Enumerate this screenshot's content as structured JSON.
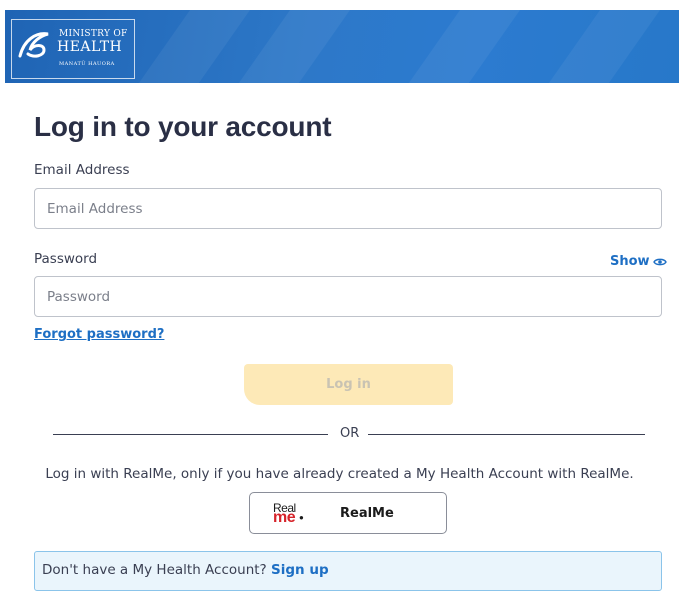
{
  "header": {
    "logo": {
      "line1": "MINISTRY OF",
      "line2": "HEALTH",
      "line3": "MANATŪ HAUORA",
      "icon": "koru-icon"
    },
    "colors": {
      "banner": "#2a72c2",
      "link": "#1e6fc4",
      "login_button": "#fde9b7"
    }
  },
  "form": {
    "title": "Log in to your account",
    "email": {
      "label": "Email Address",
      "placeholder": "Email Address",
      "value": ""
    },
    "password": {
      "label": "Password",
      "placeholder": "Password",
      "value": "",
      "show_label": "Show",
      "show_icon": "eye-icon"
    },
    "forgot_label": "Forgot password?",
    "login_label": "Log in"
  },
  "divider": {
    "text": "OR"
  },
  "realme": {
    "note": "Log in with RealMe, only if you have already created a My Health Account with RealMe.",
    "logo_top": "Real",
    "logo_bottom": "me",
    "button_label": "RealMe"
  },
  "signup": {
    "prompt": "Don't have a My Health Account?",
    "link_label": "Sign up"
  }
}
